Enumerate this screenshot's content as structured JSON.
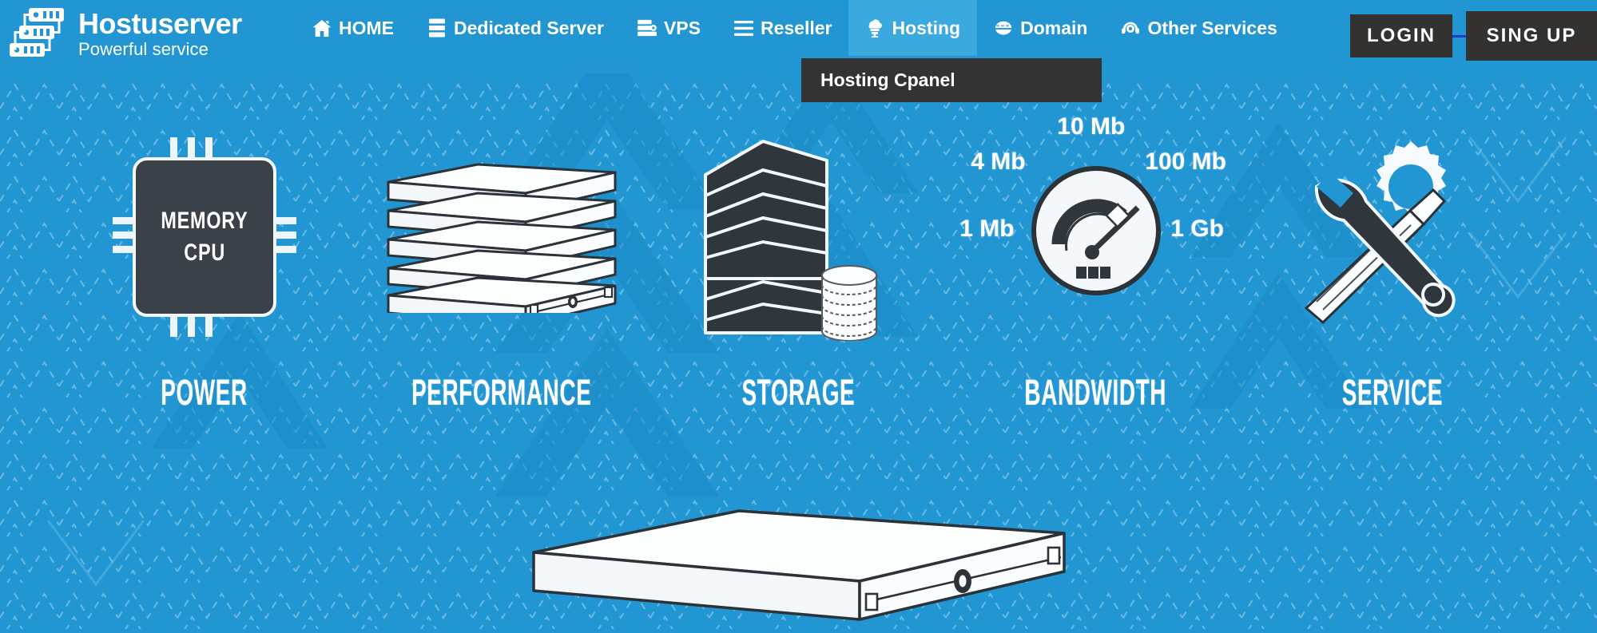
{
  "brand": {
    "name": "Hostuserver",
    "tagline": "Powerful service",
    "logo_icon": "server-stack-icon"
  },
  "nav": {
    "items": [
      {
        "label": "HOME",
        "icon": "home-icon",
        "active": false
      },
      {
        "label": "Dedicated Server",
        "icon": "server-icon",
        "active": false
      },
      {
        "label": "VPS",
        "icon": "vps-server-icon",
        "active": false
      },
      {
        "label": "Reseller",
        "icon": "hamburger-lines-icon",
        "active": false
      },
      {
        "label": "Hosting",
        "icon": "cloud-server-icon",
        "active": true
      },
      {
        "label": "Domain",
        "icon": "www-globe-icon",
        "active": false
      },
      {
        "label": "Other Services",
        "icon": "headset-support-icon",
        "active": false
      }
    ],
    "dropdown": {
      "parent": "Hosting",
      "items": [
        "Hosting Cpanel"
      ]
    }
  },
  "auth": {
    "login_label": "LOGIN",
    "signup_label": "SING UP"
  },
  "hero": {
    "features": [
      {
        "label": "POWER",
        "art": "cpu-chip-icon",
        "chip_lines": [
          "MEMORY",
          "CPU"
        ]
      },
      {
        "label": "PERFORMANCE",
        "art": "server-stack-white-icon"
      },
      {
        "label": "STORAGE",
        "art": "server-rack-dark-icon"
      },
      {
        "label": "BANDWIDTH",
        "art": "speedometer-gauge-icon",
        "gauge_labels": [
          "1 Mb",
          "4 Mb",
          "10 Mb",
          "100 Mb",
          "1 Gb"
        ]
      },
      {
        "label": "SERVICE",
        "art": "wrench-gear-screwdriver-icon"
      }
    ],
    "bottom_art": "single-server-unit-icon"
  },
  "colors": {
    "brand_blue": "#2196d3",
    "nav_active_blue": "#3aa9e0",
    "dark": "#333333",
    "button_dark": "#343231",
    "white": "#ffffff",
    "chip_body": "#3a4148",
    "divider_blue": "#1a3fc4"
  }
}
